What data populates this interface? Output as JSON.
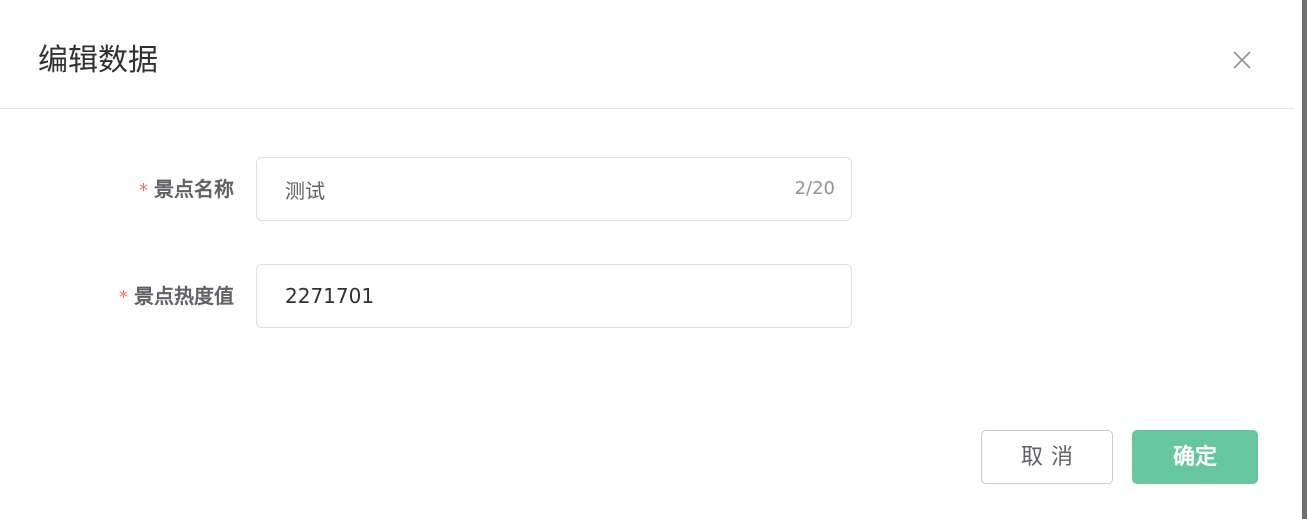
{
  "dialog": {
    "title": "编辑数据",
    "close_icon": "close-icon"
  },
  "form": {
    "name_field": {
      "required_mark": "*",
      "label": "景点名称",
      "value": "测试",
      "char_count": "2/20"
    },
    "heat_field": {
      "required_mark": "*",
      "label": "景点热度值",
      "value": "2271701"
    }
  },
  "footer": {
    "cancel_label": "取消",
    "confirm_label": "确定"
  },
  "colors": {
    "primary": "#66c79e",
    "required": "#f56c6c",
    "border": "#dcdfe6"
  }
}
